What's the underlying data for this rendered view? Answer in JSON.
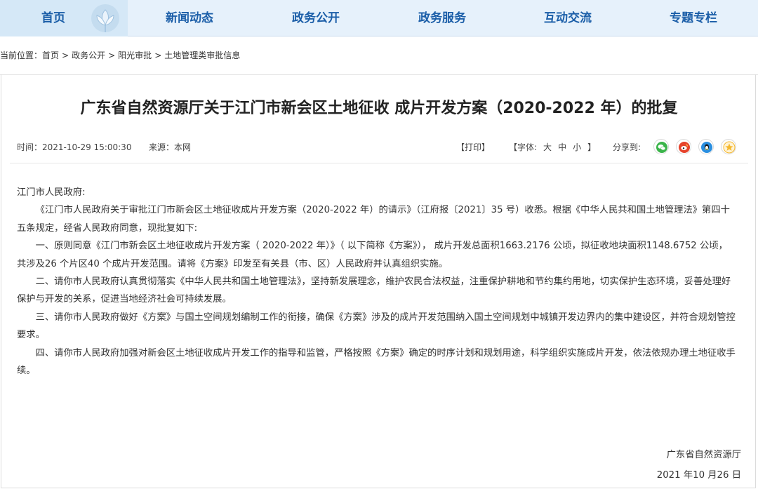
{
  "nav": {
    "items": [
      {
        "label": "首页"
      },
      {
        "label": "新闻动态"
      },
      {
        "label": "政务公开"
      },
      {
        "label": "政务服务"
      },
      {
        "label": "互动交流"
      },
      {
        "label": "专题专栏"
      }
    ]
  },
  "breadcrumb": {
    "prefix": "当前位置：",
    "items": [
      "首页",
      "政务公开",
      "阳光审批",
      "土地管理类审批信息"
    ],
    "separator": ">"
  },
  "article": {
    "title": "广东省自然资源厅关于江门市新会区土地征收 成片开发方案（2020-2022 年）的批复",
    "time": "时间：2021-10-29 15:00:30",
    "source": "来源：本网",
    "print_label": "【打印】",
    "font_label": "【字体:",
    "font_large": "大",
    "font_medium": "中",
    "font_small": "小",
    "font_close": "】",
    "share_label": "分享到:",
    "share_icons": [
      "wechat-icon",
      "weibo-icon",
      "qq-icon",
      "qzone-icon"
    ],
    "salutation": "江门市人民政府:",
    "paragraphs": [
      "《江门市人民政府关于审批江门市新会区土地征收成片开发方案（2020-2022 年）的请示》（江府报〔2021〕35 号）收悉。根据《中华人民共和国土地管理法》第四十五条规定，经省人民政府同意，现批复如下:",
      "一、原则同意《江门市新会区土地征收成片开发方案（ 2020-2022 年）》（ 以下简称《方案》），  成片开发总面积1663.2176 公顷，拟征收地块面积1148.6752 公顷，共涉及26 个片区40 个成片开发范围。请将《方案》印发至有关县（市、区）人民政府并认真组织实施。",
      "二、请你市人民政府认真贯彻落实《中华人民共和国土地管理法》，坚持新发展理念，维护农民合法权益，注重保护耕地和节约集约用地，切实保护生态环境，妥善处理好保护与开发的关系，促进当地经济社会可持续发展。",
      "三、请你市人民政府做好《方案》与国土空间规划编制工作的衔接，确保《方案》涉及的成片开发范围纳入国土空间规划中城镇开发边界内的集中建设区，并符合规划管控要求。",
      "四、请你市人民政府加强对新会区土地征收成片开发工作的指导和监管，严格按照《方案》确定的时序计划和规划用途，科学组织实施成片开发，依法依规办理土地征收手续。"
    ],
    "signature_org": "广东省自然资源厅",
    "signature_date": "2021 年10 月26 日"
  },
  "colors": {
    "nav_bg": "#e6f1fb",
    "nav_text": "#1b5ea8",
    "wechat": "#3bb44a",
    "weibo": "#e6432c",
    "qq": "#2a8fe0",
    "qzone": "#f5b82e"
  }
}
